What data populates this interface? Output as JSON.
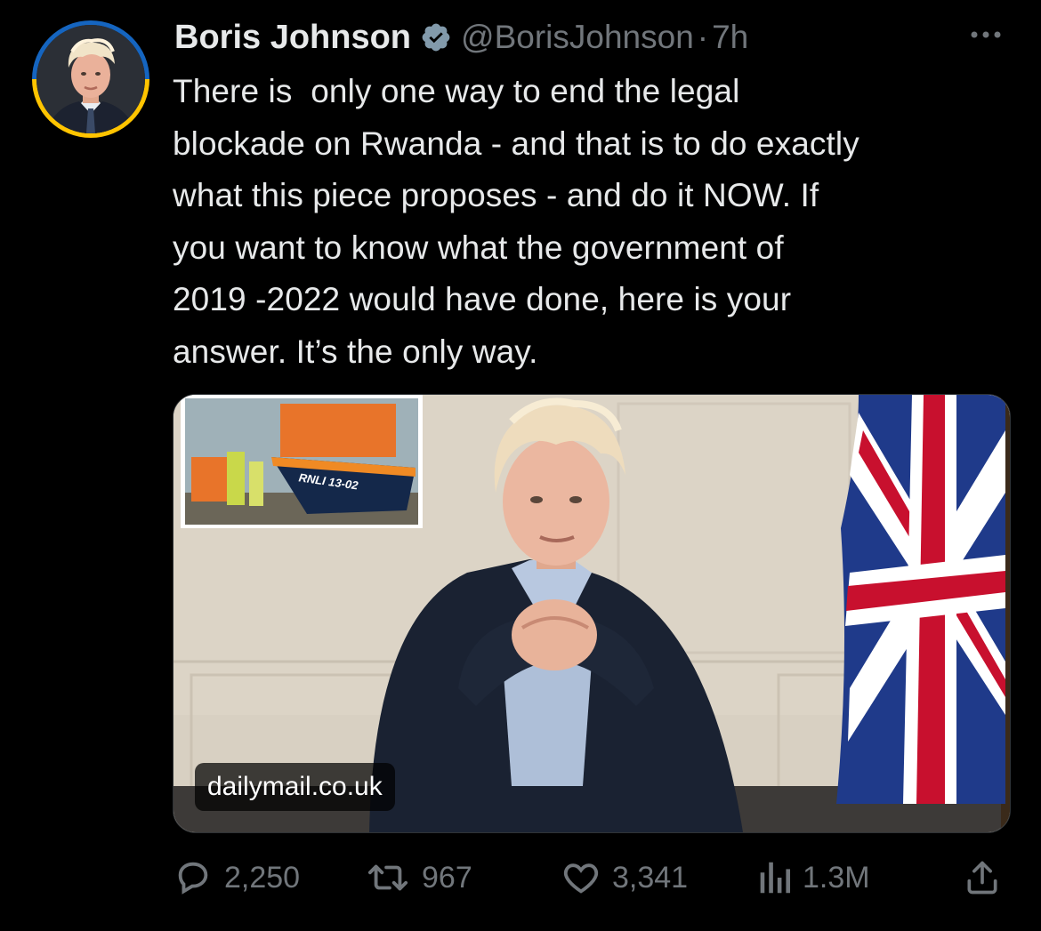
{
  "author": {
    "display_name": "Boris Johnson",
    "handle": "@BorisJohnson",
    "separator": "·",
    "time": "7h",
    "verified": true,
    "avatar_ring_colors": [
      "#1565c0",
      "#ffc400"
    ]
  },
  "tweet": {
    "text": "There is  only one way to end the legal\nblockade on Rwanda - and that is to do exactly\nwhat this piece proposes - and do it NOW. If\nyou want to know what the government of\n2019 -2022 would have done, here is your\nanswer. It’s the only way."
  },
  "media": {
    "source_domain": "dailymail.co.uk",
    "inset_boat_text": "RNLI 13-02"
  },
  "actions": {
    "replies": "2,250",
    "retweets": "967",
    "likes": "3,341",
    "views": "1.3M"
  },
  "colors": {
    "background": "#000000",
    "text_primary": "#e7e9ea",
    "text_secondary": "#71767b",
    "verified_badge": "#829aab"
  },
  "icons": [
    "verified-badge-icon",
    "more-options-icon",
    "reply-icon",
    "retweet-icon",
    "like-icon",
    "views-icon",
    "share-icon"
  ]
}
